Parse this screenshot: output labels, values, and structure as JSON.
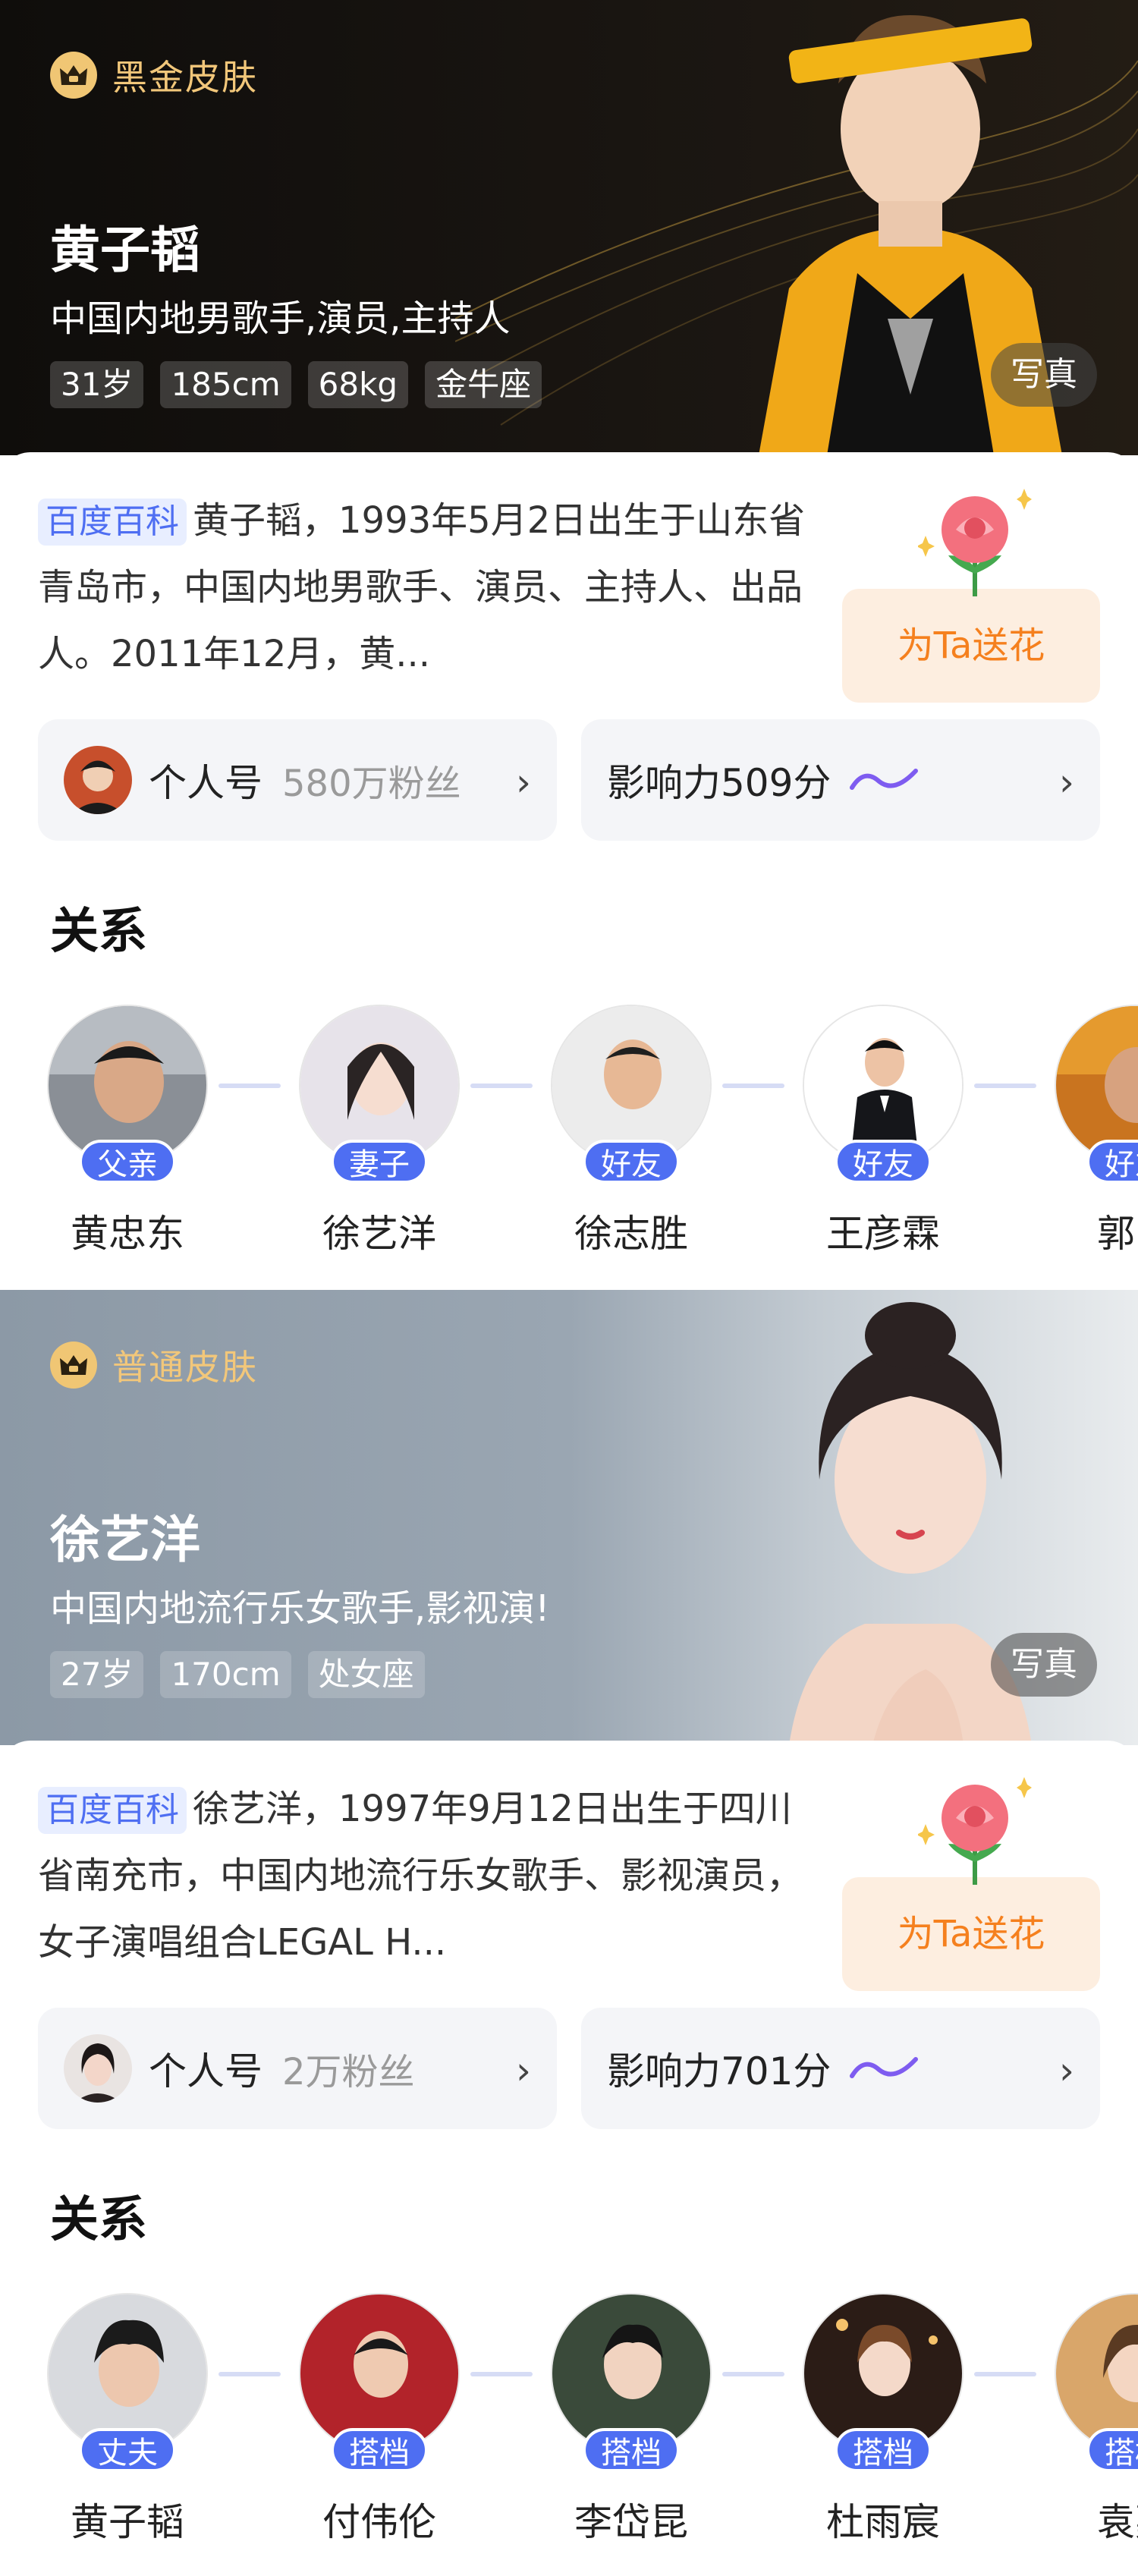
{
  "cards": [
    {
      "skin_label": "黑金皮肤",
      "name": "黄子韬",
      "subtitle": "中国内地男歌手,演员,主持人",
      "tags": [
        "31岁",
        "185cm",
        "68kg",
        "金牛座"
      ],
      "photo_button": "写真",
      "baike_badge": "百度百科",
      "intro": "黄子韬，1993年5月2日出生于山东省青岛市，中国内地男歌手、演员、主持人、出品人。2011年12月，黄...",
      "flower_button": "为Ta送花",
      "personal_label": "个人号",
      "fans": "580万粉丝",
      "influence": "影响力509分",
      "chevron": "›",
      "relations_title": "关系",
      "relations": [
        {
          "name": "黄忠东",
          "role": "父亲"
        },
        {
          "name": "徐艺洋",
          "role": "妻子"
        },
        {
          "name": "徐志胜",
          "role": "好友"
        },
        {
          "name": "王彦霖",
          "role": "好友"
        },
        {
          "name": "郭品",
          "role": "好友"
        }
      ]
    },
    {
      "skin_label": "普通皮肤",
      "name": "徐艺洋",
      "subtitle": "中国内地流行乐女歌手,影视演!",
      "tags": [
        "27岁",
        "170cm",
        "处女座"
      ],
      "photo_button": "写真",
      "baike_badge": "百度百科",
      "intro": "徐艺洋，1997年9月12日出生于四川省南充市，中国内地流行乐女歌手、影视演员，女子演唱组合LEGAL H...",
      "flower_button": "为Ta送花",
      "personal_label": "个人号",
      "fans": "2万粉丝",
      "influence": "影响力701分",
      "chevron": "›",
      "relations_title": "关系",
      "relations": [
        {
          "name": "黄子韬",
          "role": "丈夫"
        },
        {
          "name": "付伟伦",
          "role": "搭档"
        },
        {
          "name": "李岱昆",
          "role": "搭档"
        },
        {
          "name": "杜雨宸",
          "role": "搭档"
        },
        {
          "name": "袁嘉",
          "role": "搭档"
        }
      ]
    }
  ],
  "colors": {
    "accent_blue": "#4e6ef2",
    "gold": "#f2c77a",
    "flower_orange": "#f5801e"
  }
}
